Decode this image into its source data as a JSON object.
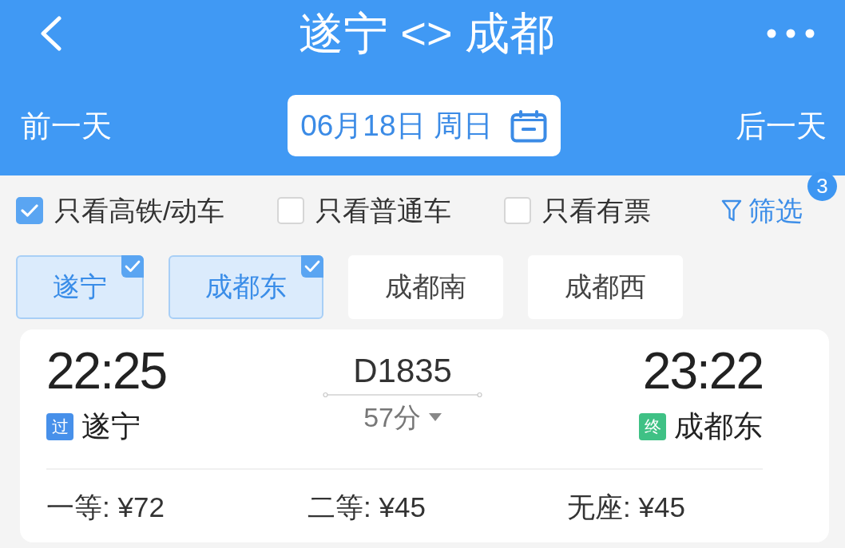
{
  "header": {
    "title": "遂宁 <> 成都",
    "prev_day": "前一天",
    "date": "06月18日 周日",
    "next_day": "后一天"
  },
  "filters": [
    {
      "label": "只看高铁/动车",
      "checked": true
    },
    {
      "label": "只看普通车",
      "checked": false
    },
    {
      "label": "只看有票",
      "checked": false
    }
  ],
  "filter_button": {
    "label": "筛选",
    "badge": "3"
  },
  "stations": [
    {
      "name": "遂宁",
      "selected": true
    },
    {
      "name": "成都东",
      "selected": true
    },
    {
      "name": "成都南",
      "selected": false
    },
    {
      "name": "成都西",
      "selected": false
    }
  ],
  "trains": [
    {
      "depart": {
        "time": "22:25",
        "station": "遂宁",
        "tag": {
          "text": "过",
          "color": "#4790ea"
        }
      },
      "train_no": "D1835",
      "duration": "57分",
      "arrive": {
        "time": "23:22",
        "station": "成都东",
        "tag": {
          "text": "终",
          "color": "#3fc185"
        }
      },
      "seats": [
        {
          "label": "一等: ¥72"
        },
        {
          "label": "二等: ¥45"
        },
        {
          "label": "无座: ¥45"
        }
      ]
    }
  ]
}
